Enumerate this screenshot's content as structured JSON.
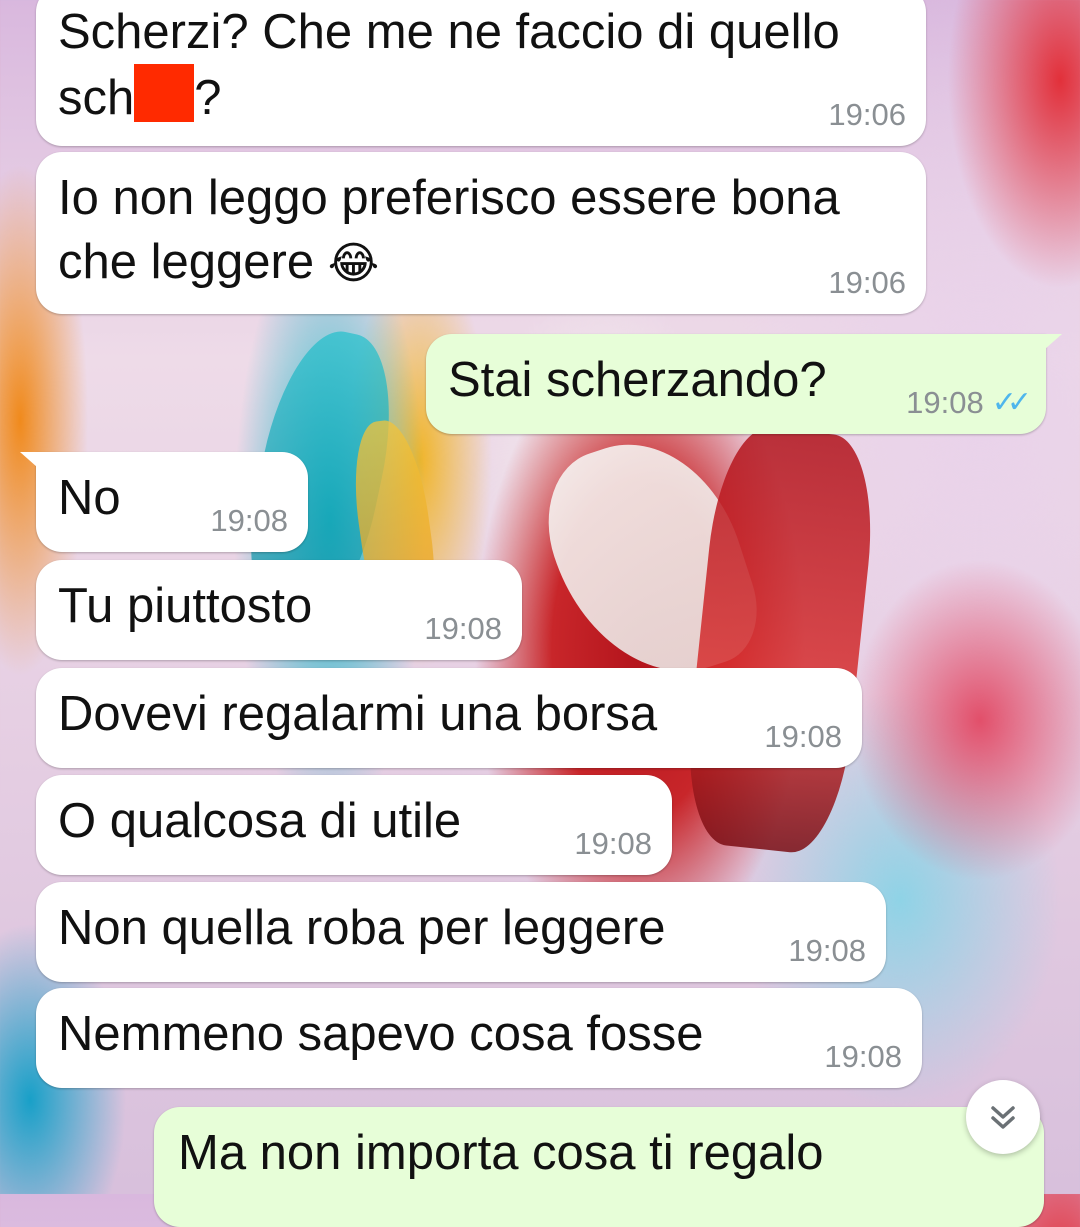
{
  "chat": {
    "messages": [
      {
        "direction": "in",
        "text_before": "Scherzi? Che me ne faccio di quello\nsch",
        "text_after": "?",
        "time": "19:06",
        "redacted": true
      },
      {
        "direction": "in",
        "text": "Io non leggo preferisco essere bona\nche leggere",
        "emoji": "😂",
        "time": "19:06"
      },
      {
        "direction": "out",
        "text": "Stai scherzando?",
        "time": "19:08",
        "status": "read"
      },
      {
        "direction": "in",
        "text": "No",
        "time": "19:08"
      },
      {
        "direction": "in",
        "text": "Tu piuttosto",
        "time": "19:08"
      },
      {
        "direction": "in",
        "text": "Dovevi regalarmi una borsa",
        "time": "19:08"
      },
      {
        "direction": "in",
        "text": "O qualcosa di utile",
        "time": "19:08"
      },
      {
        "direction": "in",
        "text": "Non quella roba per leggere",
        "time": "19:08"
      },
      {
        "direction": "in",
        "text": "Nemmeno sapevo cosa fosse",
        "time": "19:08"
      },
      {
        "direction": "out",
        "text": "Ma non importa cosa ti regalo",
        "time": ""
      }
    ],
    "read_ticks": "✓✓",
    "scroll_button_icon": "double-chevron-down-icon"
  },
  "colors": {
    "incoming_bubble": "#ffffff",
    "outgoing_bubble": "#e7fed8",
    "read_tick": "#4fb6ec",
    "timestamp": "#8a8f93",
    "redaction": "#ff2a00"
  }
}
